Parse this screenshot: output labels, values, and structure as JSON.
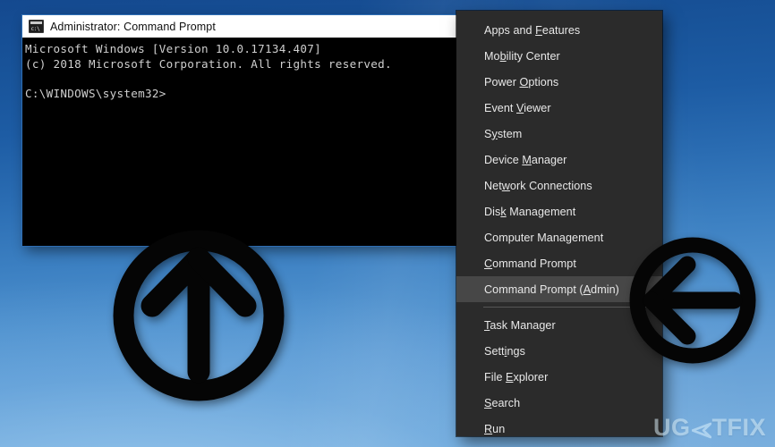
{
  "desktop": {
    "background_top_color": "#14498f",
    "background_bottom_color": "#79aedd"
  },
  "console_window": {
    "title": "Administrator: Command Prompt",
    "icon": "console-icon",
    "lines": [
      "Microsoft Windows [Version 10.0.17134.407]",
      "(c) 2018 Microsoft Corporation. All rights reserved.",
      "",
      "C:\\WINDOWS\\system32>"
    ]
  },
  "winx_menu": {
    "items": [
      {
        "label": "Apps and Features",
        "pre": "Apps and ",
        "accel": "F",
        "post": "eatures",
        "selected": false,
        "separator_after": false
      },
      {
        "label": "Mobility Center",
        "pre": "Mo",
        "accel": "b",
        "post": "ility Center",
        "selected": false,
        "separator_after": false
      },
      {
        "label": "Power Options",
        "pre": "Power ",
        "accel": "O",
        "post": "ptions",
        "selected": false,
        "separator_after": false
      },
      {
        "label": "Event Viewer",
        "pre": "Event ",
        "accel": "V",
        "post": "iewer",
        "selected": false,
        "separator_after": false
      },
      {
        "label": "System",
        "pre": "S",
        "accel": "y",
        "post": "stem",
        "selected": false,
        "separator_after": false
      },
      {
        "label": "Device Manager",
        "pre": "Device ",
        "accel": "M",
        "post": "anager",
        "selected": false,
        "separator_after": false
      },
      {
        "label": "Network Connections",
        "pre": "Net",
        "accel": "w",
        "post": "ork Connections",
        "selected": false,
        "separator_after": false
      },
      {
        "label": "Disk Management",
        "pre": "Dis",
        "accel": "k",
        "post": " Management",
        "selected": false,
        "separator_after": false
      },
      {
        "label": "Computer Management",
        "pre": "Computer Mana",
        "accel": "g",
        "post": "ement",
        "selected": false,
        "separator_after": false
      },
      {
        "label": "Command Prompt",
        "pre": "",
        "accel": "C",
        "post": "ommand Prompt",
        "selected": false,
        "separator_after": false
      },
      {
        "label": "Command Prompt (Admin)",
        "pre": "Command Prompt (",
        "accel": "A",
        "post": "dmin)",
        "selected": true,
        "separator_after": true
      },
      {
        "label": "Task Manager",
        "pre": "",
        "accel": "T",
        "post": "ask Manager",
        "selected": false,
        "separator_after": false
      },
      {
        "label": "Settings",
        "pre": "Sett",
        "accel": "i",
        "post": "ngs",
        "selected": false,
        "separator_after": false
      },
      {
        "label": "File Explorer",
        "pre": "File ",
        "accel": "E",
        "post": "xplorer",
        "selected": false,
        "separator_after": false
      },
      {
        "label": "Search",
        "pre": "",
        "accel": "S",
        "post": "earch",
        "selected": false,
        "separator_after": false
      },
      {
        "label": "Run",
        "pre": "",
        "accel": "R",
        "post": "un",
        "selected": false,
        "separator_after": false
      }
    ],
    "highlight_color": "#474747",
    "background_color": "#2b2b2b"
  },
  "annotations": {
    "arrow_up": "arrow-up-circle-icon",
    "arrow_left": "arrow-left-circle-icon",
    "arrow_color": "#000000"
  },
  "watermark": {
    "part1": "UG",
    "part2": "TFIX",
    "color": "#e1f5ff"
  }
}
